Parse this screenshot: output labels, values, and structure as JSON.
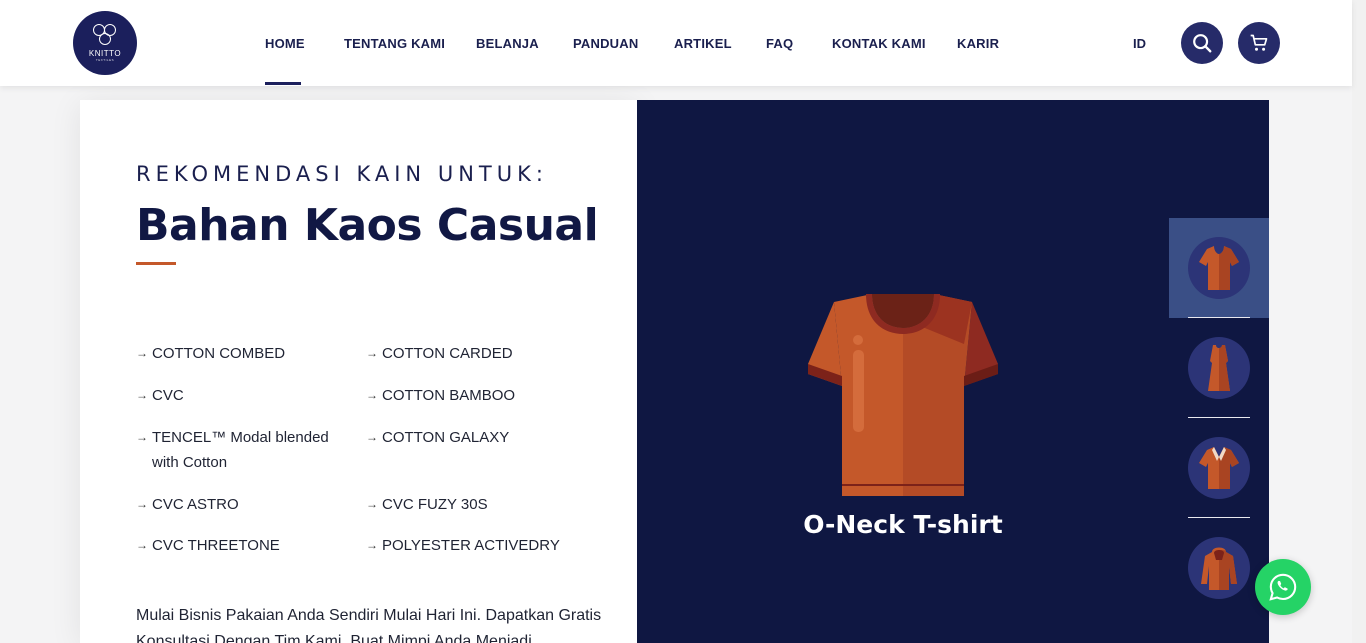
{
  "header": {
    "logo": {
      "text": "KNITTO",
      "subtext": "TEXTILES"
    },
    "nav": [
      "HOME",
      "TENTANG KAMI",
      "BELANJA",
      "PANDUAN",
      "ARTIKEL",
      "FAQ",
      "KONTAK KAMI",
      "KARIR"
    ],
    "active_nav": "HOME",
    "language": "ID",
    "icons": {
      "search": "search-icon",
      "cart": "cart-icon"
    }
  },
  "main": {
    "eyebrow": "REKOMENDASI KAIN UNTUK:",
    "title": "Bahan Kaos Casual",
    "fabrics_left": [
      "COTTON COMBED",
      "CVC",
      "TENCEL™ Modal blended with Cotton",
      "CVC ASTRO",
      "CVC THREETONE"
    ],
    "fabrics_right": [
      "COTTON CARDED",
      "COTTON BAMBOO",
      "COTTON GALAXY",
      "CVC FUZY 30S",
      "POLYESTER ACTIVEDRY"
    ],
    "description": "Mulai Bisnis Pakaian Anda Sendiri Mulai Hari Ini. Dapatkan Gratis Konsultasi Dengan Tim Kami. Buat Mimpi Anda Menjadi"
  },
  "product": {
    "name": "O-Neck T-shirt",
    "thumbnails": [
      "tshirt-icon",
      "dress-icon",
      "polo-shirt-icon",
      "hoodie-icon"
    ],
    "active_thumbnail": 0
  },
  "colors": {
    "navy": "#0f1742",
    "accent": "#c4582a",
    "shirt": "#c4582a",
    "whatsapp": "#25d366"
  }
}
